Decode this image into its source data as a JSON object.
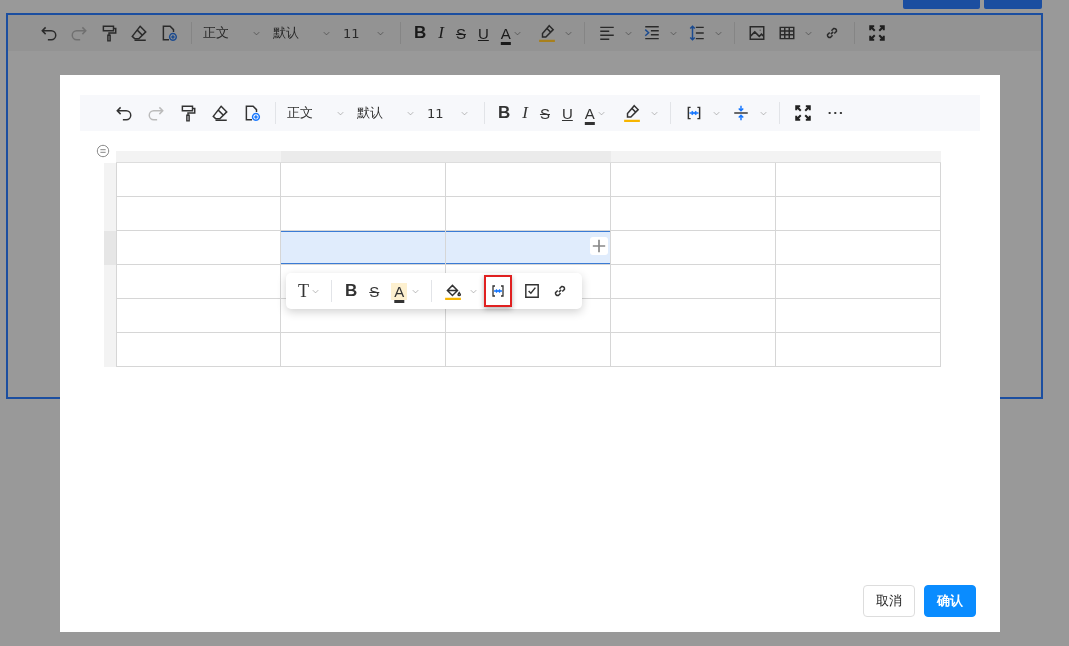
{
  "background_editor": {
    "toolbar": {
      "style": "正文",
      "font": "默认",
      "size": "11",
      "marks": [
        "B",
        "I",
        "S",
        "U",
        "A"
      ]
    }
  },
  "dialog": {
    "toolbar": {
      "style": "正文",
      "font": "默认",
      "size": "11",
      "marks": [
        "B",
        "I",
        "S",
        "U",
        "A"
      ]
    },
    "table": {
      "rows": [
        {
          "cells": [
            {
              "selected": false
            },
            {
              "selected": false
            },
            {
              "selected": false
            },
            {
              "selected": false
            },
            {
              "selected": false
            }
          ]
        },
        {
          "cells": [
            {
              "selected": false
            },
            {
              "selected": false
            },
            {
              "selected": false
            },
            {
              "selected": false
            },
            {
              "selected": false
            }
          ]
        },
        {
          "cells": [
            {
              "selected": false
            },
            {
              "selected": true
            },
            {
              "selected": true
            },
            {
              "selected": false
            },
            {
              "selected": false
            }
          ]
        },
        {
          "cells": [
            {
              "selected": false
            },
            {
              "selected": false
            },
            {
              "selected": false
            },
            {
              "selected": false
            },
            {
              "selected": false
            }
          ]
        },
        {
          "cells": [
            {
              "selected": false
            },
            {
              "selected": false
            },
            {
              "selected": false
            },
            {
              "selected": false
            },
            {
              "selected": false
            }
          ]
        },
        {
          "cells": [
            {
              "selected": false
            },
            {
              "selected": false
            },
            {
              "selected": false
            },
            {
              "selected": false
            },
            {
              "selected": false
            }
          ]
        }
      ]
    },
    "cell_toolbar": {
      "text_style": "T",
      "marks": [
        "B",
        "S",
        "A"
      ],
      "merge_highlighted": true
    },
    "buttons": [
      {
        "label": "取消",
        "kind": "secondary"
      },
      {
        "label": "确认",
        "kind": "primary"
      }
    ]
  }
}
